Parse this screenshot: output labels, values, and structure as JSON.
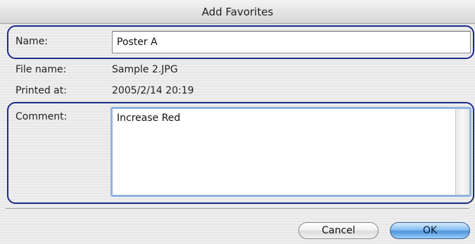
{
  "window": {
    "title": "Add Favorites"
  },
  "form": {
    "name_label": "Name:",
    "name_value": "Poster A",
    "file_name_label": "File name:",
    "file_name_value": "Sample 2.JPG",
    "printed_at_label": "Printed at:",
    "printed_at_value": "2005/2/14 20:19",
    "comment_label": "Comment:",
    "comment_value": "Increase Red"
  },
  "buttons": {
    "cancel_label": "Cancel",
    "ok_label": "OK"
  },
  "colors": {
    "highlight_outline": "#1c2a8a",
    "focus_ring": "#8fb4e0",
    "default_button": "#4e93db"
  }
}
